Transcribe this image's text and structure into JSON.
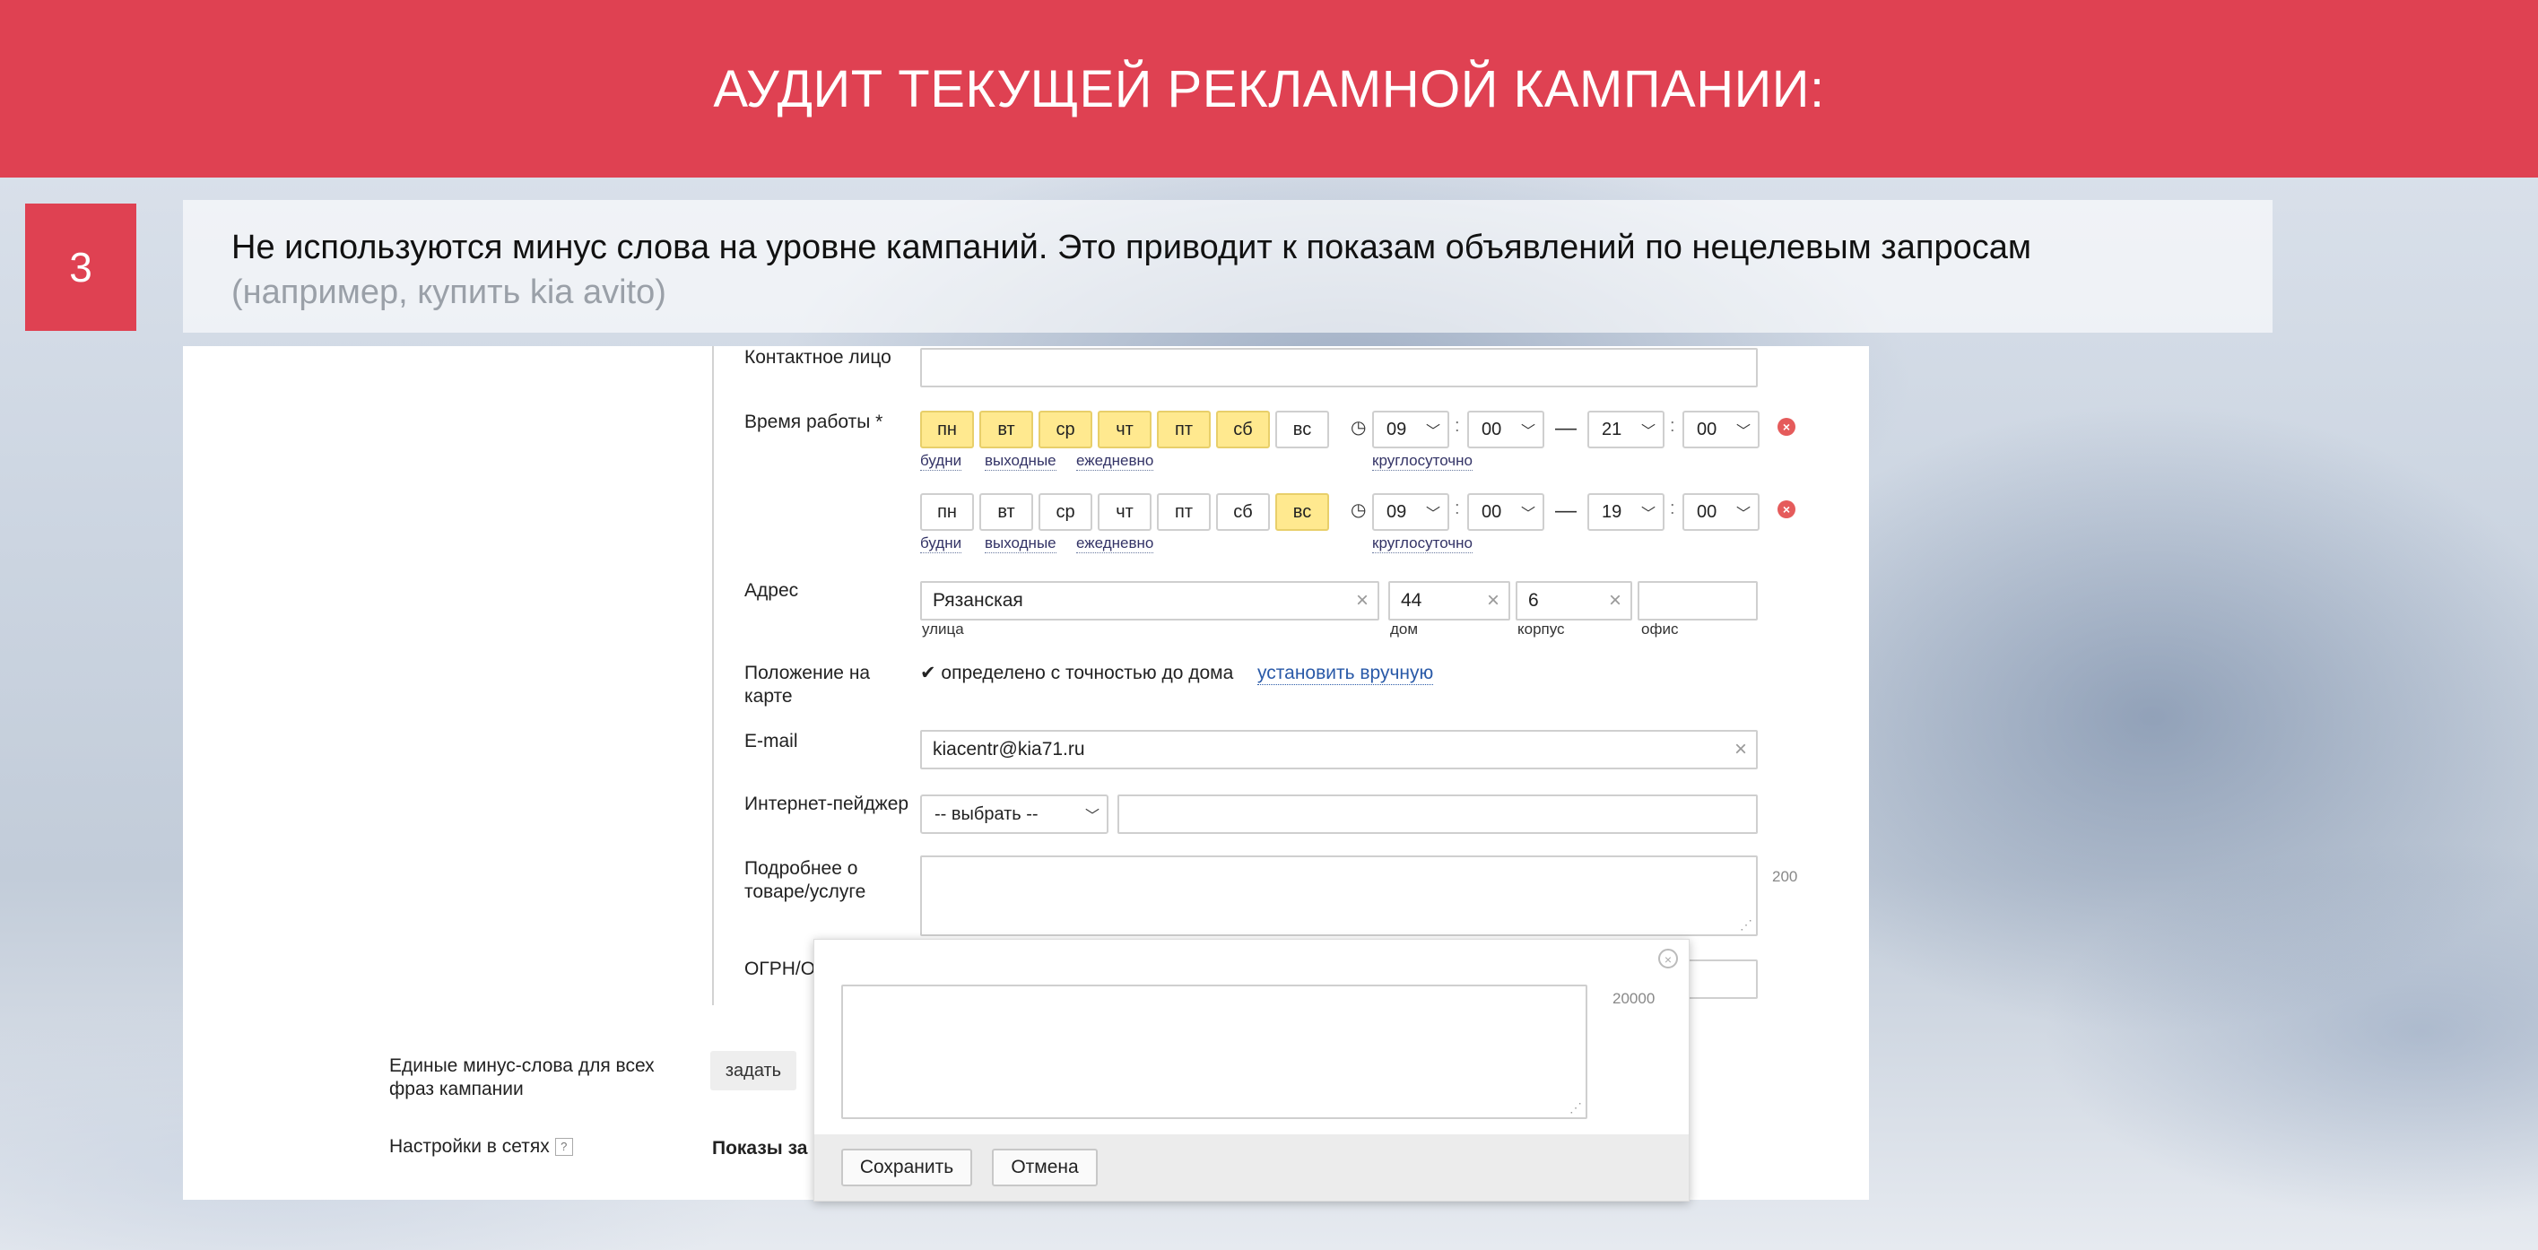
{
  "banner": {
    "title": "АУДИТ ТЕКУЩЕЙ РЕКЛАМНОЙ КАМПАНИИ:"
  },
  "note": {
    "number": "3",
    "line1": "Не используются минус слова на уровне кампаний. Это приводит к показам объявлений по нецелевым запросам",
    "line2": "(например, купить kia avito)"
  },
  "form": {
    "contact_label": "Контактное лицо",
    "hours_label": "Время работы *",
    "days": [
      "пн",
      "вт",
      "ср",
      "чт",
      "пт",
      "сб",
      "вс"
    ],
    "row1": {
      "active_days": [
        true,
        true,
        true,
        true,
        true,
        true,
        false
      ],
      "from_h": "09",
      "from_m": "00",
      "to_h": "21",
      "to_m": "00"
    },
    "row2": {
      "active_days": [
        false,
        false,
        false,
        false,
        false,
        false,
        true
      ],
      "from_h": "09",
      "from_m": "00",
      "to_h": "19",
      "to_m": "00"
    },
    "quick_links": [
      "будни",
      "выходные",
      "ежедневно"
    ],
    "round_the_clock": "круглосуточно",
    "time_sep": ":",
    "range_dash": "—",
    "address_label": "Адрес",
    "street_value": "Рязанская",
    "house_value": "44",
    "building_value": "6",
    "office_value": "",
    "street_sub": "улица",
    "house_sub": "дом",
    "building_sub": "корпус",
    "office_sub": "офис",
    "map_label_1": "Положение на",
    "map_label_2": "карте",
    "map_status": "✔ определено с точностью до дома",
    "map_link": "установить вручную",
    "email_label": "E-mail",
    "email_value": "kiacentr@kia71.ru",
    "pager_label": "Интернет-пейджер",
    "pager_select": "-- выбрать --",
    "details_label_1": "Подробнее о",
    "details_label_2": "товаре/услуге",
    "details_counter": "200",
    "ogrn_label": "ОГРН/ОГ"
  },
  "campaign": {
    "minus_label_1": "Единые минус-слова для всех",
    "minus_label_2": "фраз кампании",
    "set_button": "задать",
    "networks_label": "Настройки в сетях",
    "help_mark": "?",
    "shows_label": "Показы за"
  },
  "popup": {
    "counter": "20000",
    "save": "Сохранить",
    "cancel": "Отмена"
  }
}
